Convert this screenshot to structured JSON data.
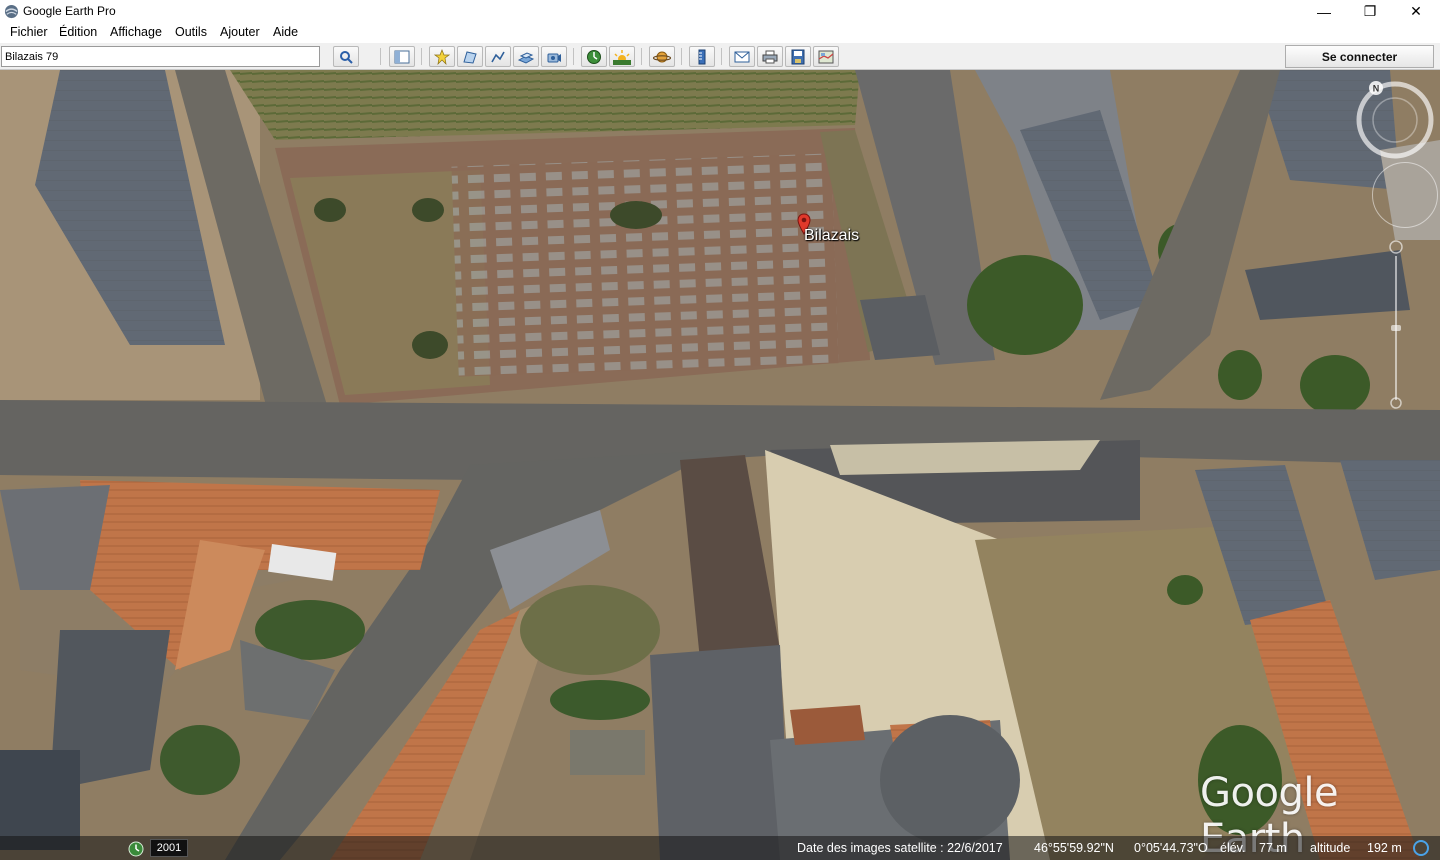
{
  "window": {
    "title": "Google Earth Pro",
    "min_glyph": "—",
    "max_glyph": "❐",
    "close_glyph": "✕"
  },
  "menu": [
    {
      "label": "Fichier"
    },
    {
      "label": "Édition"
    },
    {
      "label": "Affichage"
    },
    {
      "label": "Outils"
    },
    {
      "label": "Ajouter"
    },
    {
      "label": "Aide"
    }
  ],
  "toolbar": {
    "search_value": "Bilazais 79",
    "icons": [
      "search-icon",
      "sidebar-toggle-icon",
      "placemark-add-icon",
      "polygon-add-icon",
      "path-add-icon",
      "image-overlay-add-icon",
      "record-tour-icon",
      "historical-imagery-icon",
      "sun-icon",
      "planets-icon",
      "ruler-icon",
      "email-icon",
      "print-icon",
      "save-image-icon",
      "google-maps-icon"
    ],
    "connect_label": "Se connecter"
  },
  "map": {
    "placemark_label": "Bilazais",
    "compass_north": "N",
    "watermark": "Google Earth"
  },
  "status": {
    "year": "2001",
    "imagery_date": "Date des images satellite : 22/6/2017",
    "lat": "46°55'59.92\"N",
    "lon": "0°05'44.73\"O",
    "elev_label": "élév.",
    "elev_value": "77 m",
    "alt_label": "altitude",
    "alt_value": "192 m"
  }
}
